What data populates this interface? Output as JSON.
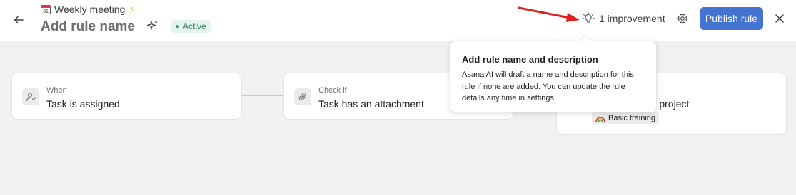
{
  "header": {
    "project_name": "Weekly meeting",
    "project_emoji": "⚡",
    "calendar_day": "31",
    "title": "Add rule name",
    "status": "Active",
    "improvement_label": "1 improvement",
    "publish_label": "Publish rule"
  },
  "colors": {
    "accent": "#4573d2",
    "status_bg": "#e6f4ee",
    "status_text": "#2e7d5b",
    "arrow": "#e02020"
  },
  "cards": [
    {
      "label": "When",
      "value": "Task is assigned",
      "icon": "user-icon"
    },
    {
      "label": "Check if",
      "value": "Task has an attachment",
      "icon": "paperclip-icon"
    },
    {
      "value": "onal project",
      "tag": "Basic training",
      "tag_icon": "rainbow-icon"
    }
  ],
  "tooltip": {
    "title": "Add rule name and description",
    "body": "Asana AI will draft a name and description for this rule if none are added. You can update the rule details any time in settings."
  }
}
